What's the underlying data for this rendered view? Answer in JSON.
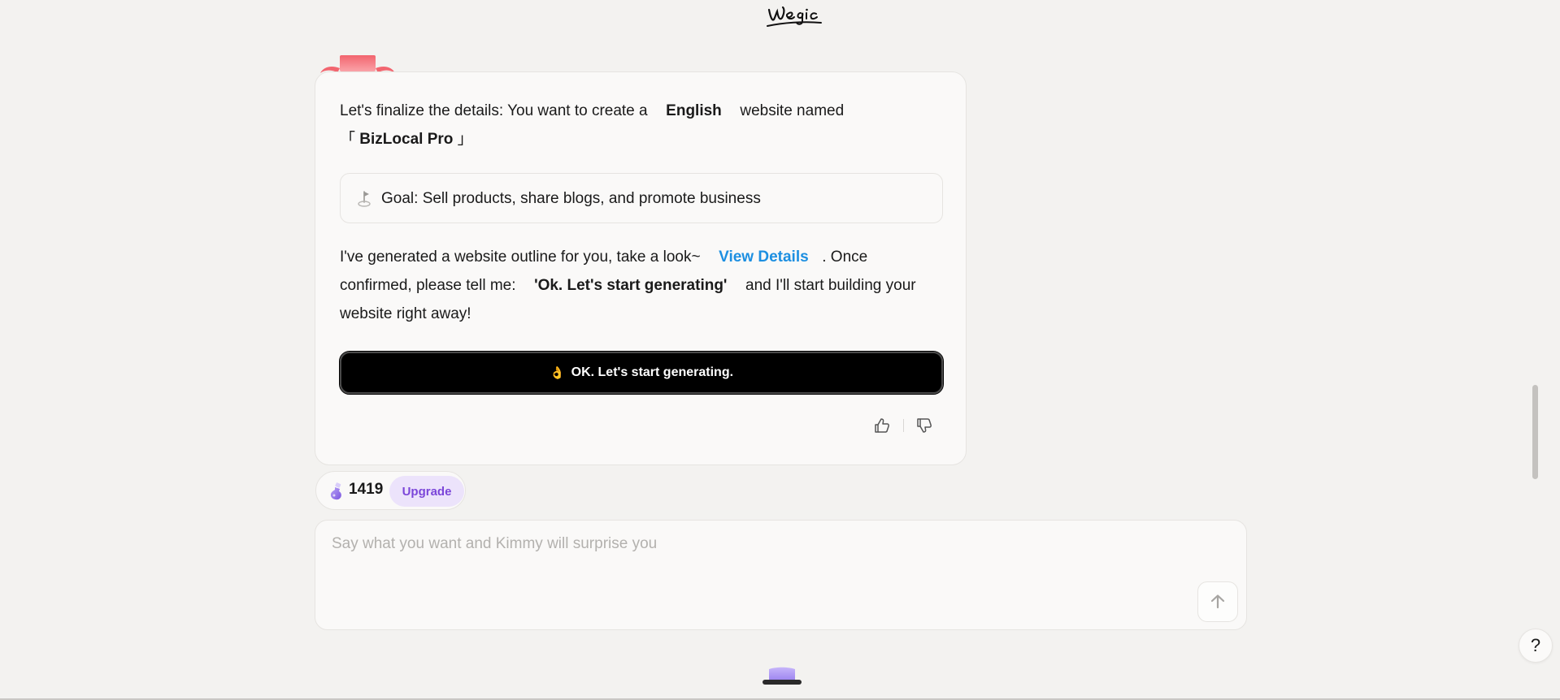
{
  "header": {
    "logo_text": "Wegic"
  },
  "message": {
    "line1_prefix": "Let's finalize the details: You want to create a",
    "language": "English",
    "line1_suffix": "website named",
    "name_open": "「",
    "site_name": "BizLocal Pro",
    "name_close": "」",
    "goal": "Goal: Sell products, share blogs, and promote business",
    "line3_prefix": "I've generated a website outline for you, take a look~",
    "view_details": "View Details",
    "line3_suffix": ". Once",
    "line4_prefix": "confirmed, please tell me:",
    "confirm_phrase": "'Ok. Let's start generating'",
    "line4_suffix": "and I'll start building your",
    "line5": "website right away!",
    "start_button_emoji": "👌",
    "start_button_label": "OK. Let's start generating."
  },
  "credits": {
    "count": "1419",
    "upgrade_label": "Upgrade"
  },
  "input": {
    "placeholder": "Say what you want and Kimmy will surprise you",
    "value": ""
  },
  "help": {
    "label": "?"
  },
  "colors": {
    "background": "#f3f2f0",
    "card": "#faf9f8",
    "link": "#1d8fe1",
    "upgrade_bg": "#ece3fb",
    "upgrade_text": "#7b46d9",
    "button_bg": "#000000"
  },
  "icons": {
    "logo": "wegic-logo",
    "bow": "bow-decoration-icon",
    "goal": "flag-icon",
    "thumbs_up": "thumbs-up-icon",
    "thumbs_down": "thumbs-down-icon",
    "credits": "potion-icon",
    "send": "arrow-up-icon",
    "mascot": "hat-icon"
  }
}
